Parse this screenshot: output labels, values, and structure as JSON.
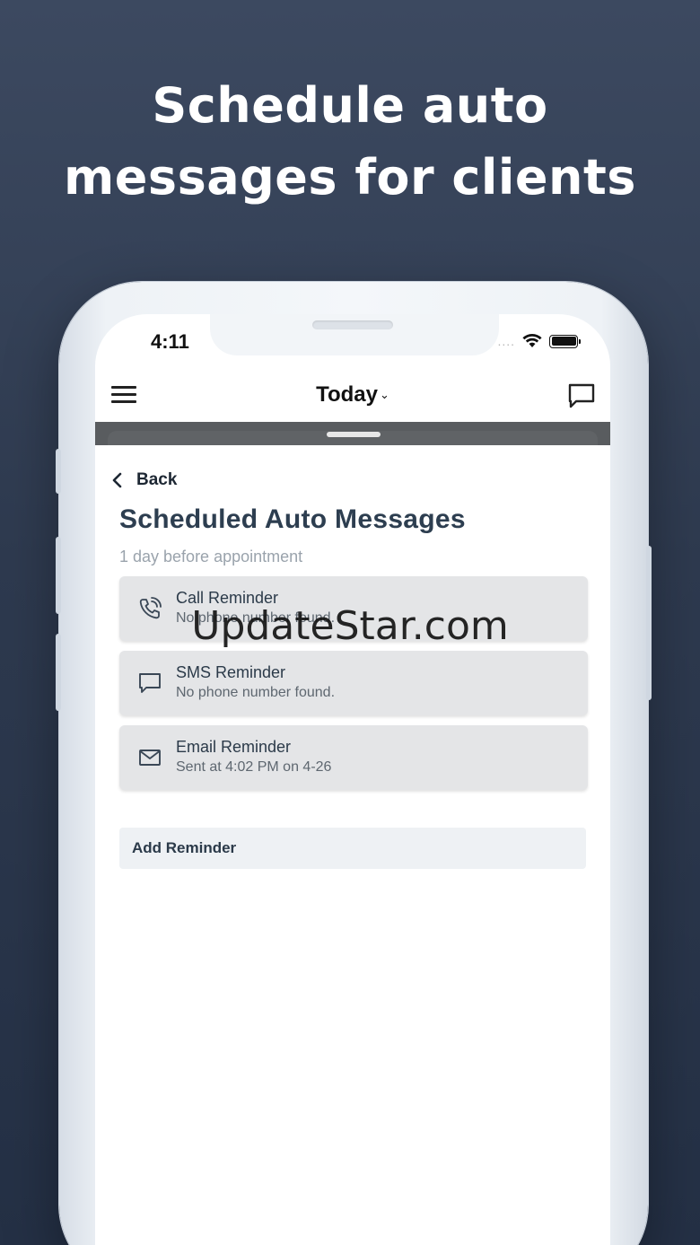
{
  "headline": {
    "line1": "Schedule auto",
    "line2": "messages for clients"
  },
  "status_bar": {
    "time": "4:11",
    "dots": "....",
    "icons": [
      "wifi-icon",
      "battery-icon"
    ]
  },
  "navbar": {
    "title": "Today",
    "chevron": "⌄",
    "left_icon": "hamburger-menu-icon",
    "right_icon": "chat-bubble-icon"
  },
  "sheet": {
    "back_label": "Back",
    "title": "Scheduled Auto Messages",
    "subtitle": "1 day before appointment",
    "reminders": [
      {
        "icon": "phone-icon",
        "title": "Call Reminder",
        "detail": "No phone number found."
      },
      {
        "icon": "message-icon",
        "title": "SMS Reminder",
        "detail": "No phone number found."
      },
      {
        "icon": "email-icon",
        "title": "Email Reminder",
        "detail": "Sent at 4:02 PM on 4-26"
      }
    ],
    "add_label": "Add Reminder"
  },
  "watermark": "UpdateStar.com",
  "colors": {
    "background": "#36435a",
    "title_text": "#2d3e50",
    "card_bg": "#e4e5e7",
    "grey_bar": "#595c5f"
  }
}
